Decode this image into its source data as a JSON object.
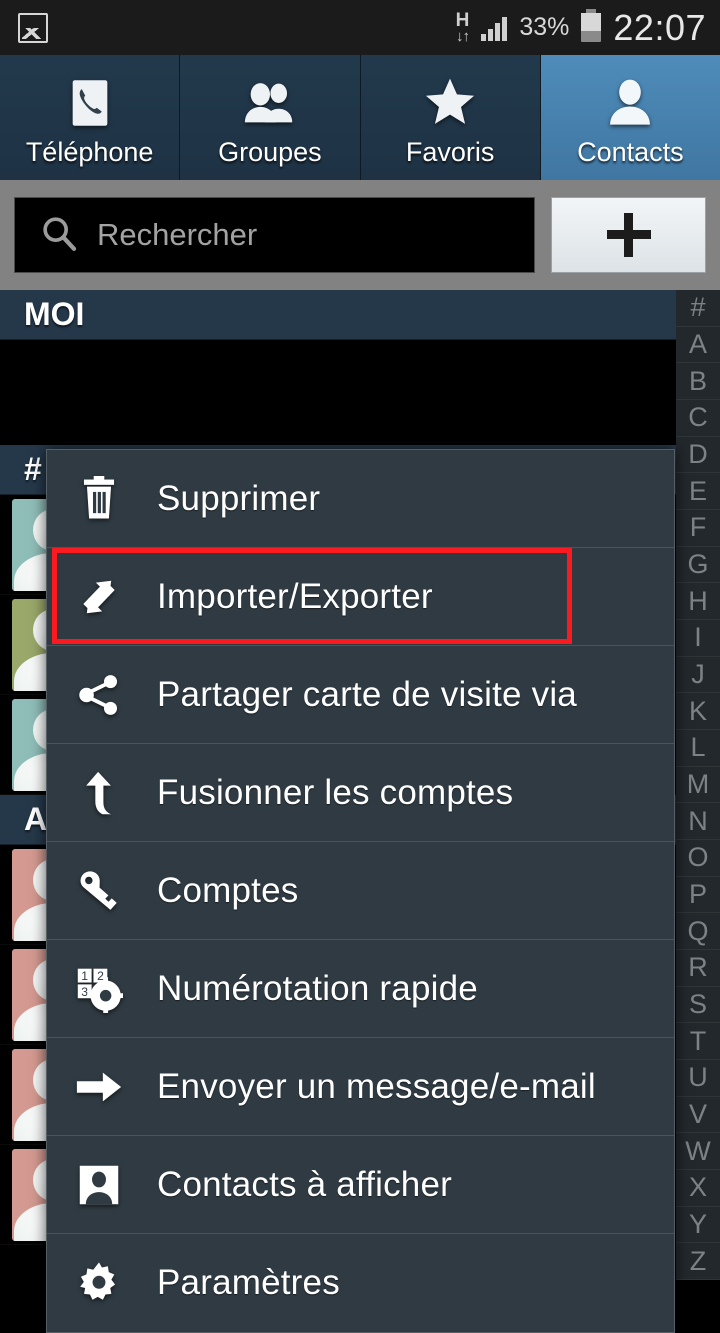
{
  "status_bar": {
    "gallery_icon": "gallery-icon",
    "network_type": "H",
    "network_arrows": "↓↑",
    "signal_icon": "signal-bars-icon",
    "battery_percent": "33%",
    "battery_icon": "battery-icon",
    "time": "22:07"
  },
  "tabs": [
    {
      "label": "Téléphone",
      "icon": "phone-icon",
      "active": false
    },
    {
      "label": "Groupes",
      "icon": "groups-icon",
      "active": false
    },
    {
      "label": "Favoris",
      "icon": "star-icon",
      "active": false
    },
    {
      "label": "Contacts",
      "icon": "person-icon",
      "active": true
    }
  ],
  "search": {
    "placeholder": "Rechercher",
    "icon": "search-icon"
  },
  "add_button": {
    "label": "+",
    "icon": "plus-icon"
  },
  "list": {
    "me_header": "MOI",
    "sections": [
      {
        "header": "#",
        "rows": [
          {
            "avatar_color": "#8fbdb8"
          },
          {
            "avatar_color": "#9aa86a"
          },
          {
            "avatar_color": "#8fbdb8"
          }
        ]
      },
      {
        "header": "A",
        "rows": [
          {
            "avatar_color": "#d49a91"
          },
          {
            "avatar_color": "#d49a91"
          },
          {
            "avatar_color": "#d49a91"
          },
          {
            "avatar_color": "#d49a91"
          }
        ]
      }
    ]
  },
  "alphabet_index": [
    "#",
    "A",
    "B",
    "C",
    "D",
    "E",
    "F",
    "G",
    "H",
    "I",
    "J",
    "K",
    "L",
    "M",
    "N",
    "O",
    "P",
    "Q",
    "R",
    "S",
    "T",
    "U",
    "V",
    "W",
    "X",
    "Y",
    "Z"
  ],
  "menu": {
    "items": [
      {
        "label": "Supprimer",
        "icon": "trash-icon",
        "highlighted": false
      },
      {
        "label": "Importer/Exporter",
        "icon": "import-export-icon",
        "highlighted": true
      },
      {
        "label": "Partager carte de visite via",
        "icon": "share-icon",
        "highlighted": false
      },
      {
        "label": "Fusionner les comptes",
        "icon": "merge-arrow-icon",
        "highlighted": false
      },
      {
        "label": "Comptes",
        "icon": "key-icon",
        "highlighted": false
      },
      {
        "label": "Numérotation rapide",
        "icon": "speed-dial-icon",
        "highlighted": false
      },
      {
        "label": "Envoyer un message/e-mail",
        "icon": "arrow-right-icon",
        "highlighted": false
      },
      {
        "label": "Contacts à afficher",
        "icon": "contact-card-icon",
        "highlighted": false
      },
      {
        "label": "Paramètres",
        "icon": "gear-icon",
        "highlighted": false
      }
    ]
  },
  "colors": {
    "accent_active_tab": "#4f8cba",
    "tab_bar": "#22394c",
    "menu_bg": "#2f3a42",
    "highlight_border": "#fc1a21",
    "section_header": "#25384a"
  }
}
